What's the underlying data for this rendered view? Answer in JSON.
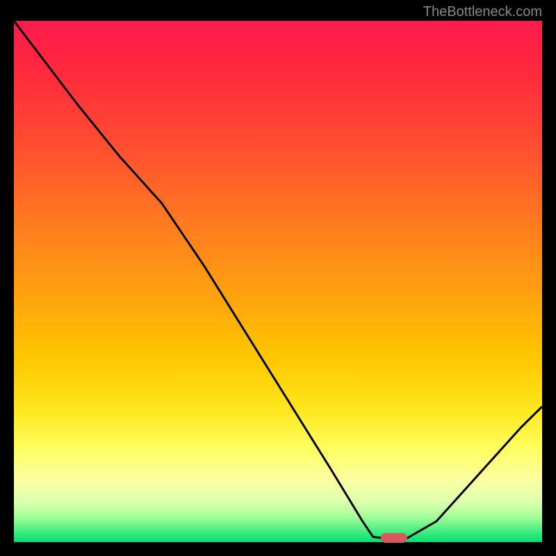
{
  "watermark": "TheBottleneck.com",
  "chart_data": {
    "type": "line",
    "title": "",
    "xlabel": "",
    "ylabel": "",
    "xlim": [
      0,
      100
    ],
    "ylim": [
      0,
      100
    ],
    "series": [
      {
        "name": "curve",
        "x": [
          0,
          12,
          20,
          28,
          36,
          44,
          52,
          60,
          66,
          68,
          72,
          74,
          80,
          88,
          96,
          100
        ],
        "values": [
          100,
          84,
          74,
          65,
          53,
          40,
          27,
          14,
          4,
          1,
          0.5,
          0.5,
          4,
          13,
          22,
          26
        ]
      }
    ],
    "minima_marker": {
      "x": 72,
      "y": 0.5
    },
    "gradient_note": "vertical background gradient from red (top) through orange, yellow to green (bottom)"
  }
}
